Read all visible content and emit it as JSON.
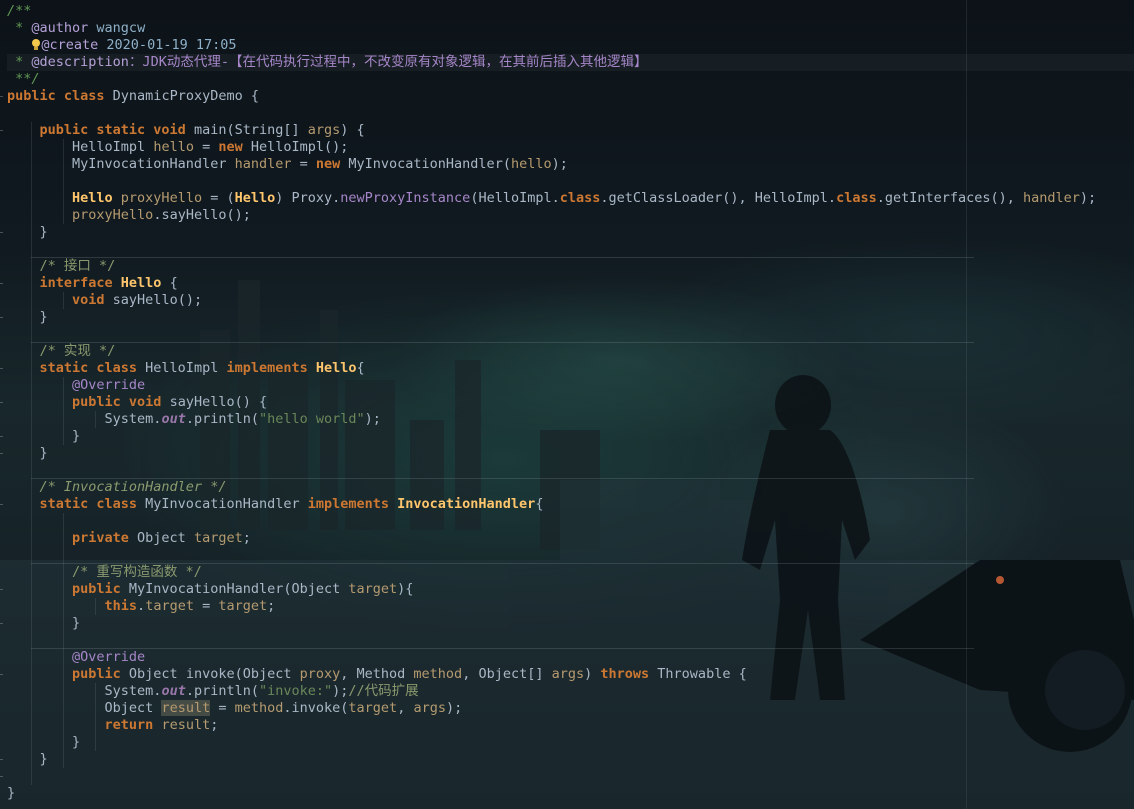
{
  "editor": {
    "accent_keyword": "#cc7832",
    "accent_string": "#6a8759",
    "accent_class": "#ffc66d",
    "background": "#121b20"
  },
  "lines": [
    {
      "hl": false,
      "sep": false,
      "tokens": [
        {
          "t": "/**",
          "c": "doc-i"
        }
      ]
    },
    {
      "hl": false,
      "sep": false,
      "tokens": [
        {
          "t": " * ",
          "c": "doc-i"
        },
        {
          "t": "@author",
          "c": "tag"
        },
        {
          "t": " wangcw",
          "c": "doc-text"
        }
      ]
    },
    {
      "hl": false,
      "sep": false,
      "bulb": true,
      "tokens": [
        {
          "t": "   ",
          "c": "doc-i"
        },
        {
          "t": "@create",
          "c": "tag"
        },
        {
          "t": " 2020-01-19 17:05",
          "c": "doc-text"
        }
      ]
    },
    {
      "hl": true,
      "sep": false,
      "tokens": [
        {
          "t": " * ",
          "c": "doc-i"
        },
        {
          "t": "@description",
          "c": "tag"
        },
        {
          "t": "：JDK动态代理-【在代码执行过程中，不改变原有对象逻辑，在其前后插入其他逻辑】",
          "c": "desc"
        }
      ]
    },
    {
      "hl": false,
      "sep": false,
      "tokens": [
        {
          "t": " **/",
          "c": "doc-i"
        }
      ]
    },
    {
      "hl": false,
      "sep": false,
      "tokens": [
        {
          "t": "public class ",
          "c": "kw"
        },
        {
          "t": "DynamicProxyDemo {",
          "c": "type"
        }
      ]
    },
    {
      "hl": false,
      "sep": false,
      "tokens": []
    },
    {
      "hl": false,
      "sep": false,
      "tokens": [
        {
          "t": "    public static void ",
          "c": "kw"
        },
        {
          "t": "main(String[] ",
          "c": "type"
        },
        {
          "t": "args",
          "c": "par"
        },
        {
          "t": ") {",
          "c": "type"
        }
      ]
    },
    {
      "hl": false,
      "sep": false,
      "tokens": [
        {
          "t": "        HelloImpl ",
          "c": "type"
        },
        {
          "t": "hello",
          "c": "par"
        },
        {
          "t": " = ",
          "c": "type"
        },
        {
          "t": "new ",
          "c": "kw"
        },
        {
          "t": "HelloImpl();",
          "c": "type"
        }
      ]
    },
    {
      "hl": false,
      "sep": false,
      "tokens": [
        {
          "t": "        MyInvocationHandler ",
          "c": "type"
        },
        {
          "t": "handler",
          "c": "par"
        },
        {
          "t": " = ",
          "c": "type"
        },
        {
          "t": "new ",
          "c": "kw"
        },
        {
          "t": "MyInvocationHandler(",
          "c": "type"
        },
        {
          "t": "hello",
          "c": "par"
        },
        {
          "t": ");",
          "c": "type"
        }
      ]
    },
    {
      "hl": false,
      "sep": false,
      "tokens": []
    },
    {
      "hl": false,
      "sep": false,
      "tokens": [
        {
          "t": "        Hello ",
          "c": "cls"
        },
        {
          "t": "proxyHello",
          "c": "par"
        },
        {
          "t": " = (",
          "c": "type"
        },
        {
          "t": "Hello",
          "c": "cls"
        },
        {
          "t": ") Proxy.",
          "c": "type"
        },
        {
          "t": "newProxyInstance",
          "c": "desc"
        },
        {
          "t": "(HelloImpl.",
          "c": "type"
        },
        {
          "t": "class",
          "c": "kw"
        },
        {
          "t": ".getClassLoader(), HelloImpl.",
          "c": "type"
        },
        {
          "t": "class",
          "c": "kw"
        },
        {
          "t": ".getInterfaces(), ",
          "c": "type"
        },
        {
          "t": "handler",
          "c": "par"
        },
        {
          "t": ");",
          "c": "type"
        }
      ]
    },
    {
      "hl": false,
      "sep": false,
      "tokens": [
        {
          "t": "        ",
          "c": "type"
        },
        {
          "t": "proxyHello",
          "c": "par"
        },
        {
          "t": ".sayHello();",
          "c": "type"
        }
      ]
    },
    {
      "hl": false,
      "sep": false,
      "tokens": [
        {
          "t": "    }",
          "c": "type"
        }
      ]
    },
    {
      "hl": false,
      "sep": false,
      "tokens": []
    },
    {
      "hl": false,
      "sep": true,
      "tokens": [
        {
          "t": "    /* 接口 */",
          "c": "com"
        }
      ]
    },
    {
      "hl": false,
      "sep": false,
      "tokens": [
        {
          "t": "    interface ",
          "c": "kw"
        },
        {
          "t": "Hello",
          "c": "cls"
        },
        {
          "t": " {",
          "c": "type"
        }
      ]
    },
    {
      "hl": false,
      "sep": false,
      "tokens": [
        {
          "t": "        void ",
          "c": "kw"
        },
        {
          "t": "sayHello();",
          "c": "type"
        }
      ]
    },
    {
      "hl": false,
      "sep": false,
      "tokens": [
        {
          "t": "    }",
          "c": "type"
        }
      ]
    },
    {
      "hl": false,
      "sep": false,
      "tokens": []
    },
    {
      "hl": false,
      "sep": true,
      "tokens": [
        {
          "t": "    /* 实现 */",
          "c": "com"
        }
      ]
    },
    {
      "hl": false,
      "sep": false,
      "tokens": [
        {
          "t": "    static class ",
          "c": "kw"
        },
        {
          "t": "HelloImpl ",
          "c": "type"
        },
        {
          "t": "implements ",
          "c": "kw"
        },
        {
          "t": "Hello",
          "c": "cls"
        },
        {
          "t": "{",
          "c": "type"
        }
      ]
    },
    {
      "hl": false,
      "sep": false,
      "tokens": [
        {
          "t": "        @Override",
          "c": "desc"
        }
      ]
    },
    {
      "hl": false,
      "sep": false,
      "tokens": [
        {
          "t": "        public void ",
          "c": "kw"
        },
        {
          "t": "sayHello() {",
          "c": "type"
        }
      ]
    },
    {
      "hl": false,
      "sep": false,
      "tokens": [
        {
          "t": "            System.",
          "c": "type"
        },
        {
          "t": "out",
          "c": "fld"
        },
        {
          "t": ".println(",
          "c": "type"
        },
        {
          "t": "\"hello world\"",
          "c": "str"
        },
        {
          "t": ");",
          "c": "type"
        }
      ]
    },
    {
      "hl": false,
      "sep": false,
      "tokens": [
        {
          "t": "        }",
          "c": "type"
        }
      ]
    },
    {
      "hl": false,
      "sep": false,
      "tokens": [
        {
          "t": "    }",
          "c": "type"
        }
      ]
    },
    {
      "hl": false,
      "sep": false,
      "tokens": []
    },
    {
      "hl": false,
      "sep": true,
      "tokens": [
        {
          "t": "    /* InvocationHandler */",
          "c": "com-i"
        }
      ]
    },
    {
      "hl": false,
      "sep": false,
      "tokens": [
        {
          "t": "    static class ",
          "c": "kw"
        },
        {
          "t": "MyInvocationHandler ",
          "c": "type"
        },
        {
          "t": "implements ",
          "c": "kw"
        },
        {
          "t": "InvocationHandler",
          "c": "cls"
        },
        {
          "t": "{",
          "c": "type"
        }
      ]
    },
    {
      "hl": false,
      "sep": false,
      "tokens": []
    },
    {
      "hl": false,
      "sep": false,
      "tokens": [
        {
          "t": "        private ",
          "c": "kw"
        },
        {
          "t": "Object ",
          "c": "type"
        },
        {
          "t": "target",
          "c": "par"
        },
        {
          "t": ";",
          "c": "type"
        }
      ]
    },
    {
      "hl": false,
      "sep": false,
      "tokens": []
    },
    {
      "hl": false,
      "sep": true,
      "tokens": [
        {
          "t": "        /* 重写构造函数 */",
          "c": "com"
        }
      ]
    },
    {
      "hl": false,
      "sep": false,
      "tokens": [
        {
          "t": "        public ",
          "c": "kw"
        },
        {
          "t": "MyInvocationHandler(Object ",
          "c": "type"
        },
        {
          "t": "target",
          "c": "par"
        },
        {
          "t": "){",
          "c": "type"
        }
      ]
    },
    {
      "hl": false,
      "sep": false,
      "tokens": [
        {
          "t": "            this",
          "c": "kw"
        },
        {
          "t": ".",
          "c": "type"
        },
        {
          "t": "target",
          "c": "par"
        },
        {
          "t": " = ",
          "c": "type"
        },
        {
          "t": "target",
          "c": "par"
        },
        {
          "t": ";",
          "c": "type"
        }
      ]
    },
    {
      "hl": false,
      "sep": false,
      "tokens": [
        {
          "t": "        }",
          "c": "type"
        }
      ]
    },
    {
      "hl": false,
      "sep": false,
      "tokens": []
    },
    {
      "hl": false,
      "sep": true,
      "tokens": [
        {
          "t": "        @Override",
          "c": "desc"
        }
      ]
    },
    {
      "hl": false,
      "sep": false,
      "tokens": [
        {
          "t": "        public ",
          "c": "kw"
        },
        {
          "t": "Object ",
          "c": "type"
        },
        {
          "t": "invoke(Object ",
          "c": "type"
        },
        {
          "t": "proxy",
          "c": "par"
        },
        {
          "t": ", Method ",
          "c": "type"
        },
        {
          "t": "method",
          "c": "par"
        },
        {
          "t": ", Object[] ",
          "c": "type"
        },
        {
          "t": "args",
          "c": "par"
        },
        {
          "t": ") ",
          "c": "type"
        },
        {
          "t": "throws ",
          "c": "kw"
        },
        {
          "t": "Throwable {",
          "c": "type"
        }
      ]
    },
    {
      "hl": false,
      "sep": false,
      "tokens": [
        {
          "t": "            System.",
          "c": "type"
        },
        {
          "t": "out",
          "c": "fld"
        },
        {
          "t": ".println(",
          "c": "type"
        },
        {
          "t": "\"invoke:\"",
          "c": "str"
        },
        {
          "t": ");",
          "c": "type"
        },
        {
          "t": "//代码扩展",
          "c": "com"
        }
      ]
    },
    {
      "hl": false,
      "sep": false,
      "tokens": [
        {
          "t": "            Object ",
          "c": "type"
        },
        {
          "t": "result",
          "c": "par",
          "boxed": true
        },
        {
          "t": " = ",
          "c": "type"
        },
        {
          "t": "method",
          "c": "par"
        },
        {
          "t": ".invoke(",
          "c": "type"
        },
        {
          "t": "target",
          "c": "par"
        },
        {
          "t": ", ",
          "c": "type"
        },
        {
          "t": "args",
          "c": "par"
        },
        {
          "t": ");",
          "c": "type"
        }
      ]
    },
    {
      "hl": false,
      "sep": false,
      "tokens": [
        {
          "t": "            return ",
          "c": "kw"
        },
        {
          "t": "result",
          "c": "par"
        },
        {
          "t": ";",
          "c": "type"
        }
      ]
    },
    {
      "hl": false,
      "sep": false,
      "tokens": [
        {
          "t": "        }",
          "c": "type"
        }
      ]
    },
    {
      "hl": false,
      "sep": false,
      "tokens": [
        {
          "t": "    }",
          "c": "type"
        }
      ]
    },
    {
      "hl": false,
      "sep": false,
      "tokens": []
    },
    {
      "hl": false,
      "sep": false,
      "tokens": [
        {
          "t": "}",
          "c": "type"
        }
      ]
    }
  ]
}
